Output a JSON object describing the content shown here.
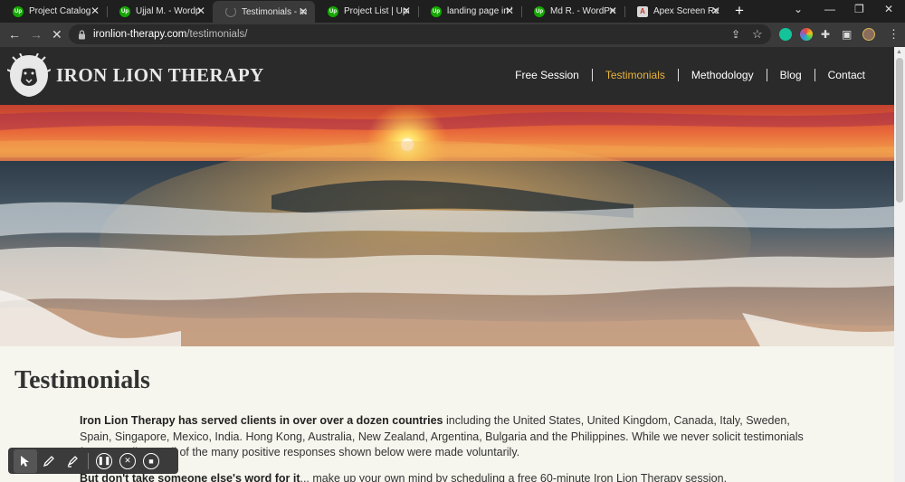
{
  "browser": {
    "tabs": [
      {
        "title": "Project Catalog |",
        "favicon": "upwork",
        "active": false
      },
      {
        "title": "Ujjal M. - Wordp",
        "favicon": "upwork",
        "active": false
      },
      {
        "title": "Testimonials - Iro",
        "favicon": "loading",
        "active": true
      },
      {
        "title": "Project List | Upw",
        "favicon": "upwork",
        "active": false
      },
      {
        "title": "landing page in \\",
        "favicon": "upwork",
        "active": false
      },
      {
        "title": "Md R. - WordPre",
        "favicon": "upwork",
        "active": false
      },
      {
        "title": "Apex Screen Rec",
        "favicon": "apex",
        "active": false
      }
    ],
    "favicon_text": "Up",
    "apex_text": "A",
    "url_domain": "ironlion-therapy.com",
    "url_path": "/testimonials/"
  },
  "site": {
    "brand": "IRON LION THERAPY",
    "nav": [
      {
        "label": "Free Session",
        "active": false
      },
      {
        "label": "Testimonials",
        "active": true
      },
      {
        "label": "Methodology",
        "active": false
      },
      {
        "label": "Blog",
        "active": false
      },
      {
        "label": "Contact",
        "active": false
      }
    ],
    "accent_color": "#e8b33a",
    "header_bg": "#2a2a2a"
  },
  "content": {
    "title": "Testimonials",
    "para1_bold": "Iron Lion Therapy has served clients in over over a dozen countries",
    "para1_rest": " including the United States, United Kingdom, Canada, Italy, Sweden, Spain, Singapore, Mexico, India. Hong Kong, Australia, New Zealand, Argentina, Bulgaria and the Philippines. While we never solicit testimonials from any",
    "para1_line3": "clients, all of the many positive responses shown below were made voluntarily.",
    "para2_bold": "But don't take someone else's word for it",
    "para2_rest": "... make up your own mind by scheduling a free 60-minute Iron Lion Therapy session."
  },
  "recorder": {
    "tools": [
      "pointer-icon",
      "pen-icon",
      "highlighter-icon",
      "pause-icon",
      "cancel-icon",
      "stop-icon"
    ]
  }
}
